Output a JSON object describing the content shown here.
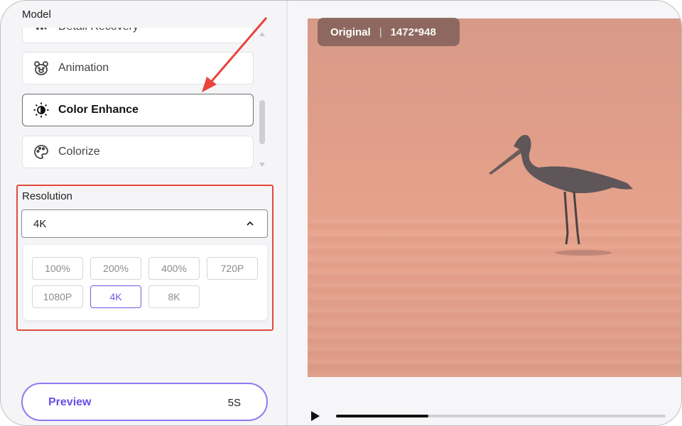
{
  "model": {
    "title": "Model",
    "items": [
      {
        "label": "Detail Recovery",
        "icon": "detail-recovery-icon"
      },
      {
        "label": "Animation",
        "icon": "bear-face-icon"
      },
      {
        "label": "Color Enhance",
        "icon": "sun-icon",
        "selected": true
      },
      {
        "label": "Colorize",
        "icon": "palette-icon"
      }
    ]
  },
  "resolution": {
    "title": "Resolution",
    "selected": "4K",
    "options": [
      "100%",
      "200%",
      "400%",
      "720P",
      "1080P",
      "4K",
      "8K"
    ]
  },
  "preview": {
    "label": "Preview",
    "time": "5S"
  },
  "image": {
    "badge_label": "Original",
    "separator": "|",
    "dimensions": "1472*948"
  },
  "player": {
    "progress_fraction": 0.28
  },
  "colors": {
    "accent": "#6c5ce7",
    "highlight_box": "#e04a3c",
    "arrow": "#e8453c"
  }
}
